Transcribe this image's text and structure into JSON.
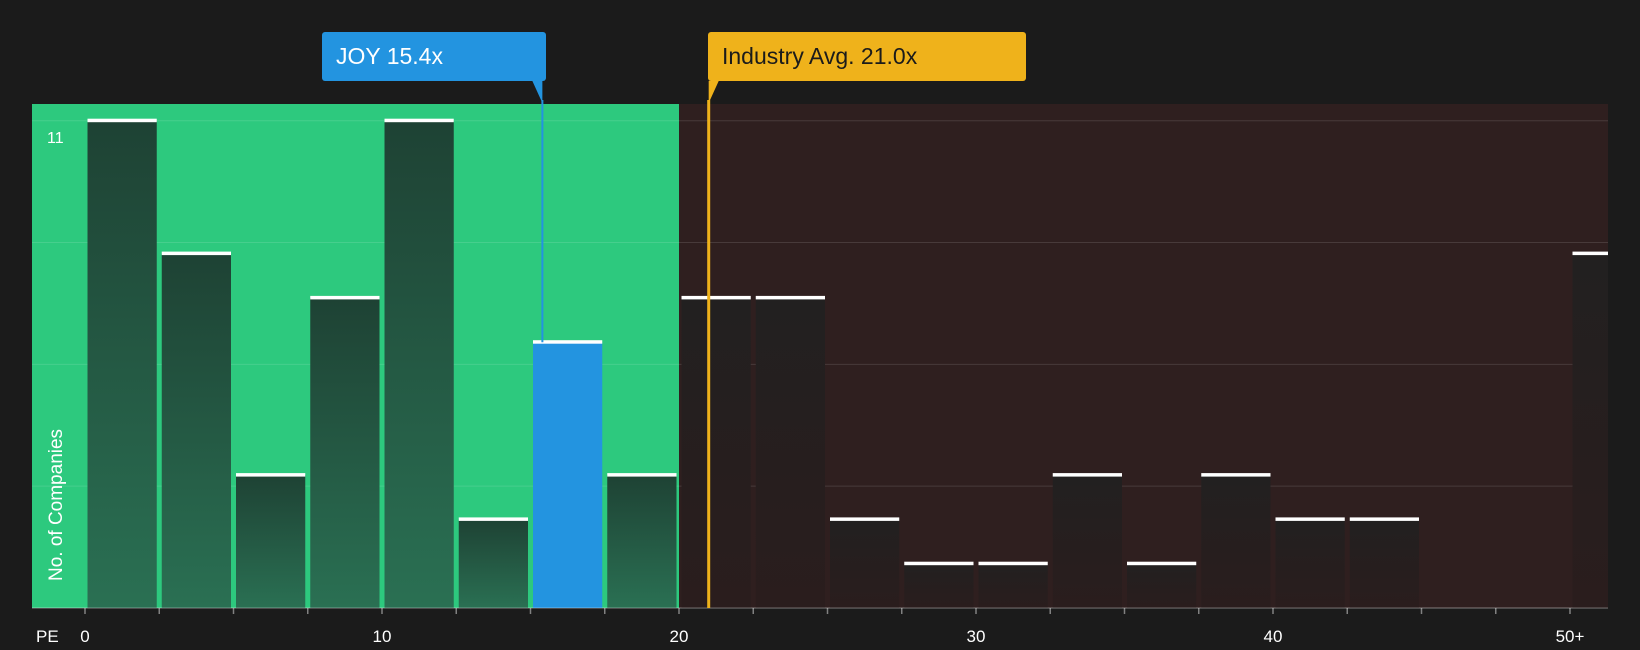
{
  "chart_data": {
    "type": "bar",
    "ylabel": "No. of Companies",
    "xlabel": "PE",
    "ylim": [
      0,
      11
    ],
    "y_tick_labels": [
      "11"
    ],
    "x_ticks": [
      0,
      10,
      20,
      30,
      40,
      50
    ],
    "x_tick_labels": [
      "0",
      "10",
      "20",
      "30",
      "40",
      "50+"
    ],
    "bin_width": 2.5,
    "bins": [
      {
        "x_start": 0,
        "value": 11
      },
      {
        "x_start": 2.5,
        "value": 8
      },
      {
        "x_start": 5,
        "value": 3
      },
      {
        "x_start": 7.5,
        "value": 7
      },
      {
        "x_start": 10,
        "value": 11
      },
      {
        "x_start": 12.5,
        "value": 2
      },
      {
        "x_start": 15,
        "value": 6,
        "highlight": true
      },
      {
        "x_start": 17.5,
        "value": 3
      },
      {
        "x_start": 20,
        "value": 7
      },
      {
        "x_start": 22.5,
        "value": 7
      },
      {
        "x_start": 25,
        "value": 2
      },
      {
        "x_start": 27.5,
        "value": 1
      },
      {
        "x_start": 30,
        "value": 1
      },
      {
        "x_start": 32.5,
        "value": 3
      },
      {
        "x_start": 35,
        "value": 1
      },
      {
        "x_start": 37.5,
        "value": 3
      },
      {
        "x_start": 40,
        "value": 2
      },
      {
        "x_start": 42.5,
        "value": 2
      },
      {
        "x_start": 45,
        "value": 0
      },
      {
        "x_start": 47.5,
        "value": 0
      },
      {
        "x_start": 50,
        "value": 8,
        "overflow": true
      }
    ],
    "regions": [
      {
        "from": 0,
        "to": 20,
        "color": "#2dc97e"
      },
      {
        "from": 20,
        "to": 51.3,
        "color": "#2f1f1f"
      }
    ],
    "markers": [
      {
        "label": "JOY 15.4x",
        "value": 15.4,
        "color": "#2394e0"
      },
      {
        "label": "Industry Avg. 21.0x",
        "value": 21.0,
        "color": "#efb21b"
      }
    ],
    "colors": {
      "background": "#1b1b1b",
      "bar_green_region": "#22473a",
      "bar_red_region": "#221e1e",
      "bar_highlight": "#2394e0",
      "bar_cap": "#ffffff",
      "text": "#ffffff",
      "label_dark": "#1b1b1b"
    }
  }
}
